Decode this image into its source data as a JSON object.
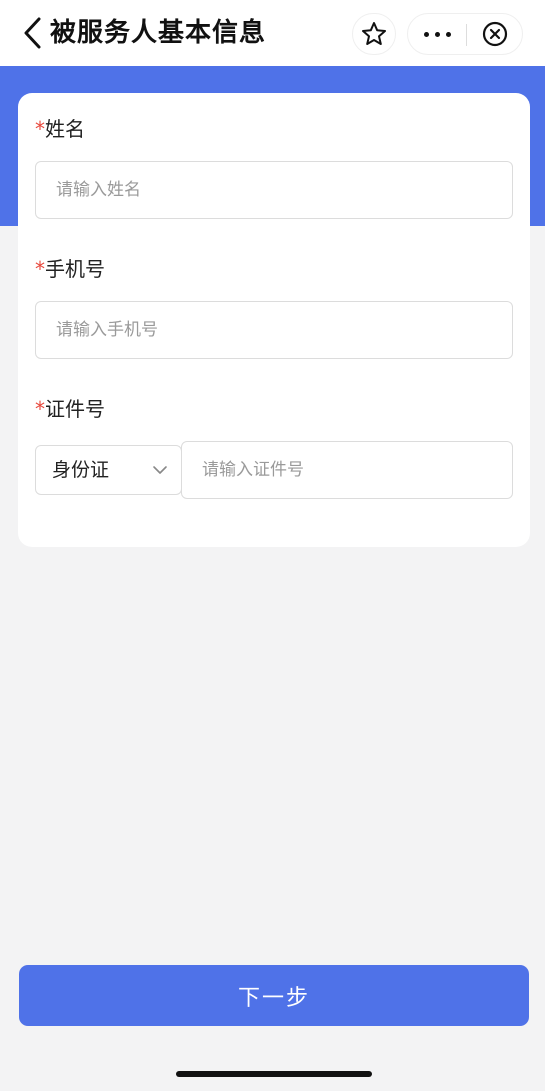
{
  "navbar": {
    "title": "被服务人基本信息",
    "icons": [
      "back-chevron-icon",
      "star-icon",
      "more-dots-icon",
      "close-circle-icon"
    ]
  },
  "form": {
    "name_field": {
      "required_mark": "*",
      "label": "姓名",
      "placeholder": "请输入姓名",
      "value": ""
    },
    "phone_field": {
      "required_mark": "*",
      "label": "手机号",
      "placeholder": "请输入手机号",
      "value": ""
    },
    "id_field": {
      "required_mark": "*",
      "label": "证件号",
      "type_selected": "身份证",
      "placeholder": "请输入证件号",
      "value": ""
    }
  },
  "footer": {
    "next_label": "下一步"
  },
  "colors": {
    "primary": "#4f72e8",
    "required": "#e8473b",
    "background": "#f3f3f4"
  }
}
